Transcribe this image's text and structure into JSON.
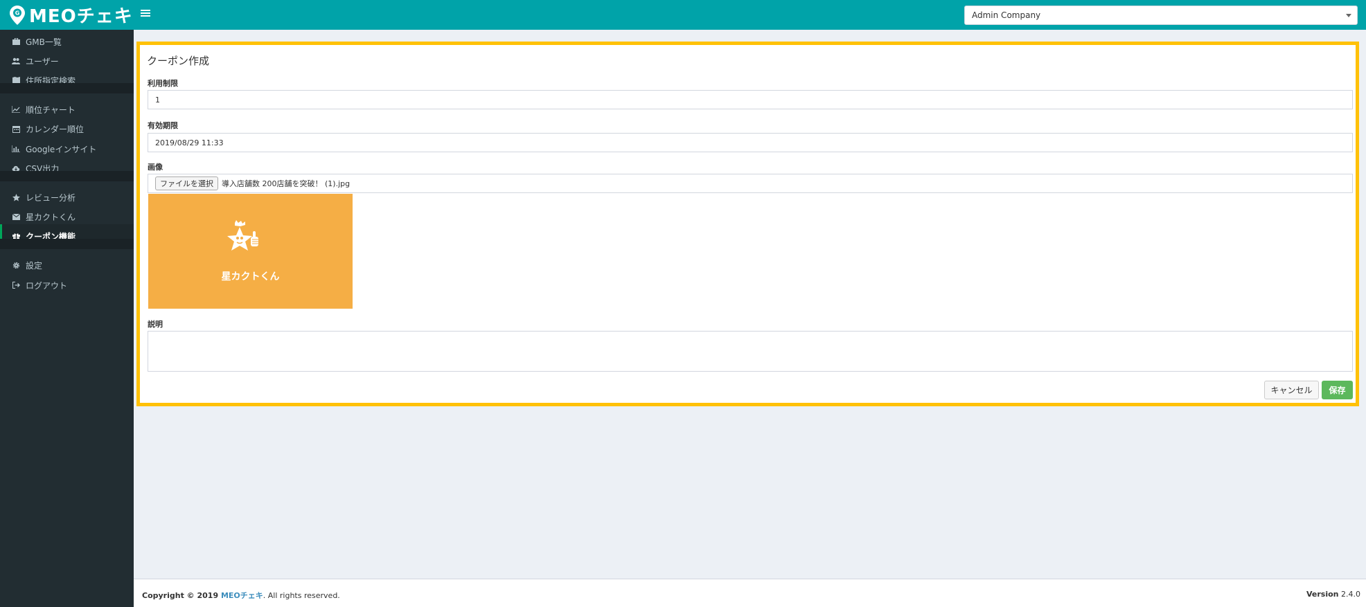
{
  "header": {
    "logo_text": "MEOチェキ",
    "company_select_value": "Admin Company"
  },
  "sidebar": {
    "items": [
      {
        "label": "GMB一覧",
        "icon": "briefcase-icon"
      },
      {
        "label": "ユーザー",
        "icon": "users-icon"
      },
      {
        "label": "住所指定検索",
        "icon": "map-icon"
      },
      {
        "label": "順位チャート",
        "icon": "line-chart-icon"
      },
      {
        "label": "カレンダー順位",
        "icon": "calendar-icon"
      },
      {
        "label": "Googleインサイト",
        "icon": "bar-chart-icon"
      },
      {
        "label": "CSV出力",
        "icon": "cloud-download-icon"
      },
      {
        "label": "レビュー分析",
        "icon": "star-icon"
      },
      {
        "label": "星カクトくん",
        "icon": "envelope-icon"
      },
      {
        "label": "クーポン機能",
        "icon": "gift-icon"
      },
      {
        "label": "設定",
        "icon": "gear-icon"
      },
      {
        "label": "ログアウト",
        "icon": "sign-out-icon"
      }
    ],
    "active_item": "クーポン機能"
  },
  "form": {
    "title": "クーポン作成",
    "usage_limit_label": "利用制限",
    "usage_limit_value": "1",
    "expiry_label": "有効期限",
    "expiry_value": "2019/08/29 11:33",
    "image_label": "画像",
    "file_button_label": "ファイルを選択",
    "file_name": "導入店舗数 200店舗を突破！ (1).jpg",
    "preview_text": "星カクトくん",
    "description_label": "説明",
    "description_value": "",
    "cancel_label": "キャンセル",
    "save_label": "保存"
  },
  "footer": {
    "copyright_prefix": "Copyright © 2019",
    "brand": "MEOチェキ",
    "copyright_suffix": ". All rights reserved.",
    "version_label": "Version",
    "version_value": "2.4.0"
  },
  "colors": {
    "header": "#00a3a9",
    "sidebar": "#222d32",
    "highlight_border": "#ffc107",
    "save_button": "#5cb85c",
    "preview_bg": "#f5ae45",
    "brand_link": "#3c8dbc"
  }
}
